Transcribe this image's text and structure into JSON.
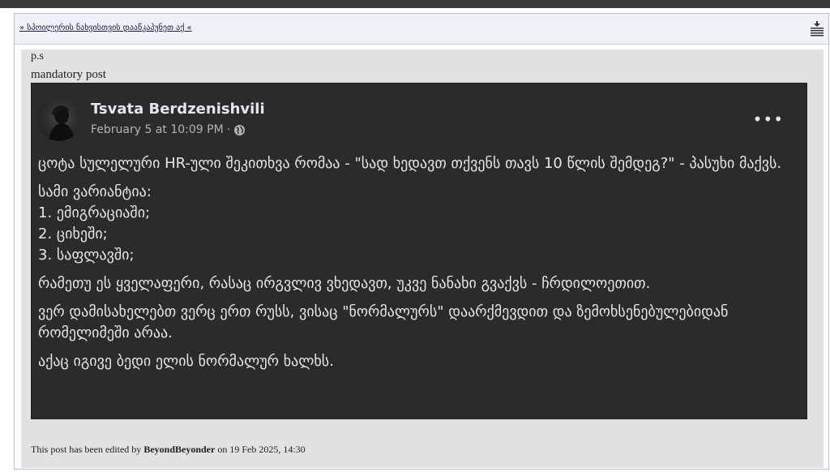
{
  "spoiler": {
    "link_text": "» სპოილერის ნახვისთვის დააწკაპუნეთ აქ «",
    "icon": "collapse-lines-icon"
  },
  "post": {
    "ps": "p.s",
    "mandatory": "mandatory post",
    "embedded": {
      "author": "Tsvata Berdzenishvili",
      "date": "February 5 at 10:09 PM",
      "separator": "·",
      "privacy_icon": "globe-icon",
      "more_icon": "more-horizontal-icon",
      "more_label": "•••",
      "paragraphs": [
        "ცოტა სულელური HR-ული შეკითხვა რომაა - \"სად ხედავთ თქვენს თავს 10 წლის შემდეგ?\" - პასუხი მაქვს.",
        "სამი ვარიანტია:\n1. ემიგრაციაში;\n2. ციხეში;\n3. საფლავში;",
        "რამეთუ ეს ყველაფერი, რასაც ირგვლივ ვხედავთ, უკვე ნანახი გვაქვს - ჩრდილოეთით.",
        "ვერ დამისახელებთ ვერც ერთ რუსს, ვისაც \"ნორმალურს\" დაარქმევდით და ზემოხსენებულებიდან რომელიმეში არაა.",
        "აქაც იგივე ბედი ელის ნორმალურ ხალხს."
      ]
    },
    "edited": {
      "prefix": "This post has been edited by",
      "user": "BeyondBeyonder",
      "suffix": "on 19 Feb 2025, 14:30"
    }
  },
  "colors": {
    "fb_background": "#2b2b2b",
    "fb_text": "#e4e6eb",
    "fb_meta": "#b0b3b8",
    "quote_background": "#e2e2e2",
    "spoiler_bar": "#eef2f6"
  }
}
